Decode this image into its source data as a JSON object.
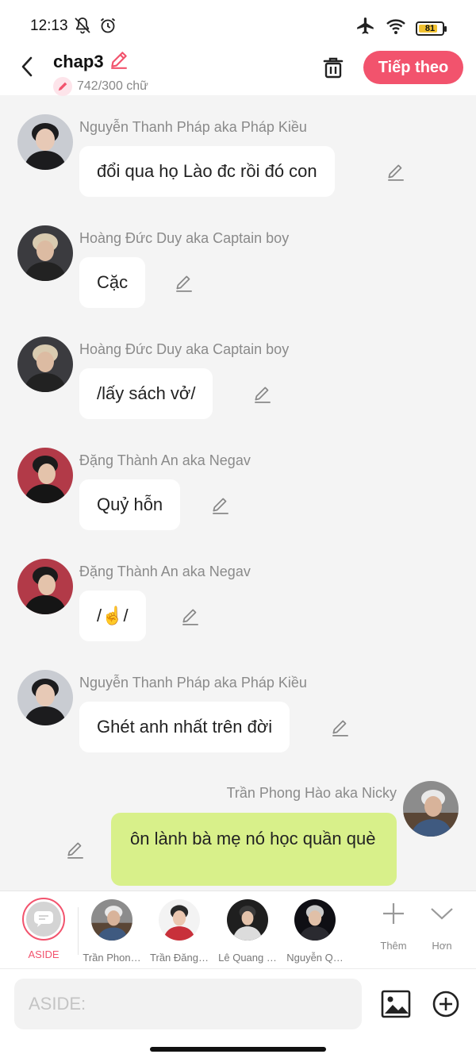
{
  "status_bar": {
    "time": "12:13",
    "battery": "81",
    "battery_fraction": 0.81,
    "icons": [
      "mute-notification-icon",
      "alarm-icon",
      "airplane-icon",
      "wifi-icon",
      "battery-icon"
    ]
  },
  "header": {
    "title": "chap3",
    "word_count": "742/300 chữ",
    "next_label": "Tiếp theo"
  },
  "messages": [
    {
      "name": "Nguyễn Thanh Pháp aka Pháp Kiều",
      "text": "đổi qua họ Lào đc rồi đó con"
    },
    {
      "name": "Hoàng Đức Duy aka Captain boy",
      "text": "Cặc"
    },
    {
      "name": "Hoàng Đức Duy aka Captain boy",
      "text": "/lấy sách vở/"
    },
    {
      "name": "Đặng Thành An aka Negav",
      "text": "Quỷ hỗn"
    },
    {
      "name": "Đặng Thành An aka Negav",
      "text": "/☝️/"
    },
    {
      "name": "Nguyễn Thanh Pháp aka Pháp Kiều",
      "text": "Ghét anh nhất trên đời"
    }
  ],
  "right_message": {
    "name": "Trần Phong Hào aka Nicky",
    "text": "ôn lành bà mẹ nó học quần què"
  },
  "character_bar": {
    "aside_label": "ASIDE",
    "characters": [
      "Trần Phon…",
      "Trần Đăng…",
      "Lê Quang …",
      "Nguyễn Q…"
    ],
    "more_label": "Thêm",
    "expand_label": "Hơn"
  },
  "input": {
    "placeholder": "ASIDE:"
  },
  "colors": {
    "accent": "#f2536d",
    "bubble_right": "#d8f08a",
    "chat_bg": "#f4f4f4"
  }
}
